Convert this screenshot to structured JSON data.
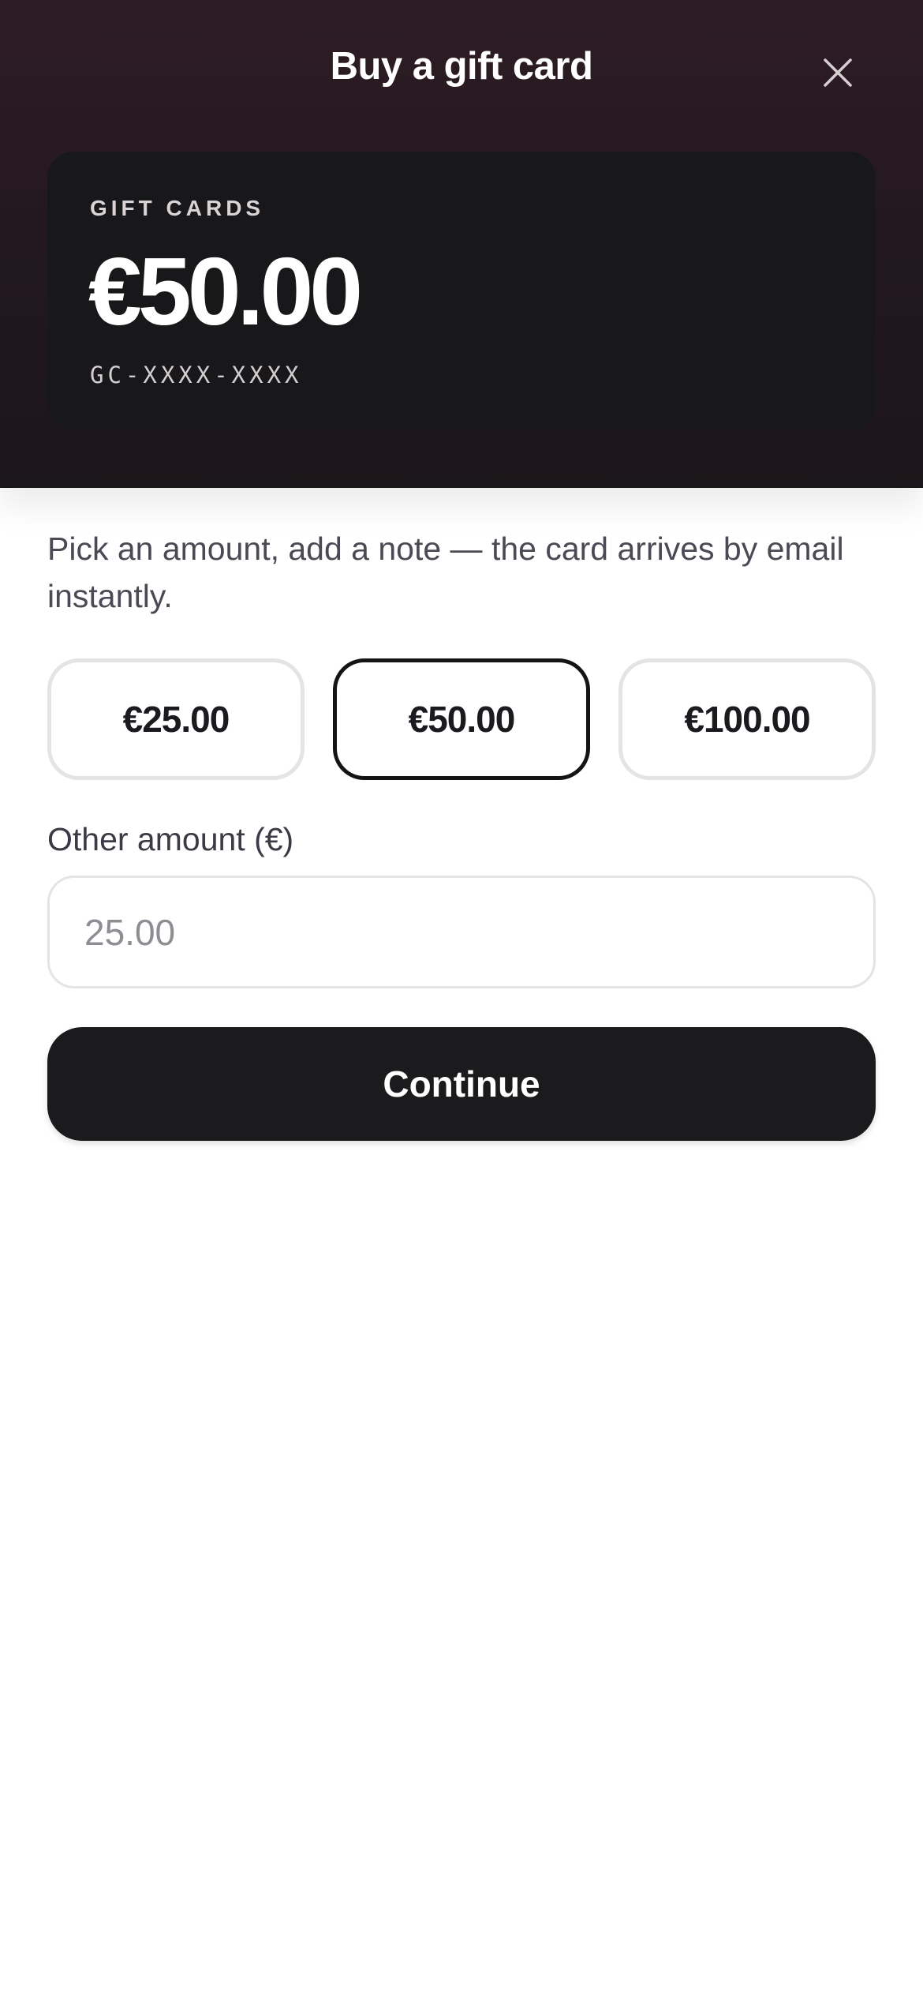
{
  "header": {
    "title": "Buy a gift card",
    "close_icon": "close-icon"
  },
  "card": {
    "eyebrow": "GIFT CARDS",
    "amount": "€50.00",
    "code": "GC-XXXX-XXXX"
  },
  "intro": "Pick an amount, add a note — the card arrives by email instantly.",
  "amounts": [
    {
      "label": "€25.00",
      "selected": false
    },
    {
      "label": "€50.00",
      "selected": true
    },
    {
      "label": "€100.00",
      "selected": false
    }
  ],
  "other_amount": {
    "label": "Other amount (€)",
    "value": "",
    "placeholder": "25.00"
  },
  "continue_label": "Continue",
  "colors": {
    "hero_background": "#2e1c24",
    "card_background": "#18171a",
    "primary_button": "#1b1b1d",
    "selected_border": "#141416",
    "unselected_border": "#e4e4e6"
  }
}
